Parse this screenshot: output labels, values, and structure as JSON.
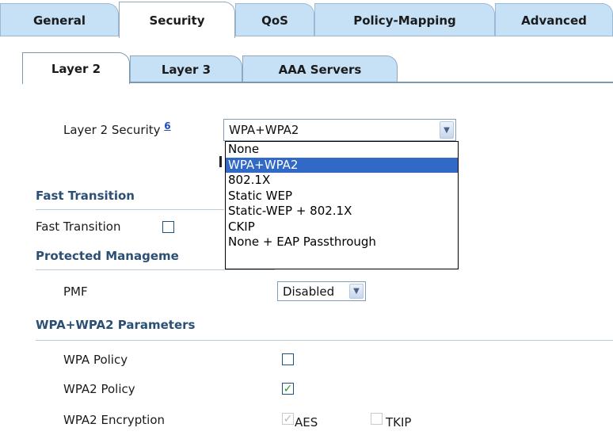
{
  "top_tabs": [
    "General",
    "Security",
    "QoS",
    "Policy-Mapping",
    "Advanced"
  ],
  "sub_tabs": [
    "Layer 2",
    "Layer 3",
    "AAA Servers"
  ],
  "layer2": {
    "label": "Layer 2 Security",
    "footnote": "6",
    "selected": "WPA+WPA2",
    "options": [
      "None",
      "WPA+WPA2",
      "802.1X",
      "Static WEP",
      "Static-WEP + 802.1X",
      "CKIP",
      "None + EAP Passthrough"
    ]
  },
  "fast_transition": {
    "section_title": "Fast Transition",
    "label": "Fast Transition",
    "checked": false
  },
  "pmf": {
    "section_title": "Protected Manageme",
    "label": "PMF",
    "value": "Disabled"
  },
  "wpa_params": {
    "section_title": "WPA+WPA2 Parameters",
    "wpa_policy_label": "WPA Policy",
    "wpa2_policy_label": "WPA2 Policy",
    "wpa2_encryption_label": "WPA2 Encryption",
    "aes_label": "AES",
    "tkip_label": "TKIP"
  },
  "colors": {
    "tab_bg": "#c6e0f6",
    "section_text": "#2c4f74",
    "selected_option_bg": "#3169c6",
    "check_green": "#21a121"
  }
}
